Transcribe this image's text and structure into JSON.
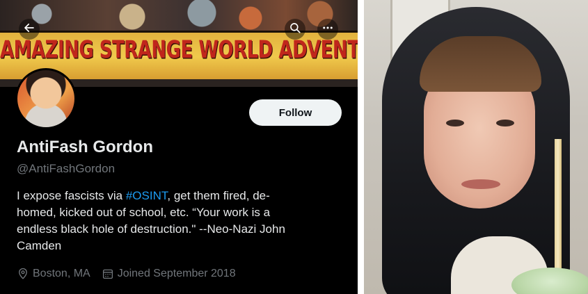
{
  "banner": {
    "headline": "AMAZING STRANGE WORLD ADVENTURES!"
  },
  "toolbar": {
    "back_icon": "arrow-left-icon",
    "search_icon": "search-icon",
    "more_icon": "more-horizontal-icon"
  },
  "profile": {
    "display_name": "AntiFash Gordon",
    "handle": "@AntiFashGordon",
    "follow_label": "Follow",
    "bio": {
      "line1_before": "I expose fascists via ",
      "line1_hashtag": "#OSINT",
      "line1_after": ", get them fired, de-",
      "line2": "homed, kicked out of school, etc. “Your work is a",
      "line3": "endless black hole of destruction.\" --Neo-Nazi John",
      "line4": "Camden"
    },
    "location": "Boston, MA",
    "joined": "Joined September 2018",
    "location_icon": "location-pin-icon",
    "joined_icon": "calendar-icon"
  },
  "colors": {
    "background": "#000000",
    "primary_text": "#e7e9ea",
    "secondary_text": "#71767b",
    "link": "#1d9bf0",
    "follow_button_bg": "#eff3f4",
    "banner_title": "#c0261c"
  }
}
